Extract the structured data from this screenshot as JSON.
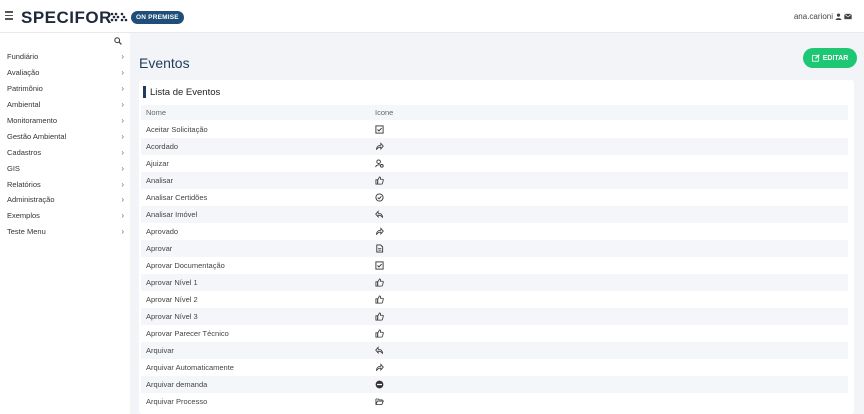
{
  "header": {
    "logo_text": "SPECIFOR",
    "badge": "ON PREMISE",
    "user": "ana.carioni"
  },
  "sidebar": {
    "items": [
      {
        "label": "Fundiário"
      },
      {
        "label": "Avaliação"
      },
      {
        "label": "Patrimônio"
      },
      {
        "label": "Ambiental"
      },
      {
        "label": "Monitoramento"
      },
      {
        "label": "Gestão Ambiental"
      },
      {
        "label": "Cadastros"
      },
      {
        "label": "GIS"
      },
      {
        "label": "Relatórios"
      },
      {
        "label": "Administração"
      },
      {
        "label": "Exemplos"
      },
      {
        "label": "Teste Menu"
      }
    ]
  },
  "page": {
    "title": "Eventos",
    "edit_label": "EDITAR"
  },
  "card": {
    "title": "Lista de Eventos",
    "col_name": "Nome",
    "col_icon": "Icone"
  },
  "events": [
    {
      "name": "Aceitar Solicitação",
      "icon": "check-square-icon"
    },
    {
      "name": "Acordado",
      "icon": "share-icon"
    },
    {
      "name": "Ajuizar",
      "icon": "user-gear-icon"
    },
    {
      "name": "Analisar",
      "icon": "thumbs-up-icon"
    },
    {
      "name": "Analisar Certidões",
      "icon": "check-circle-icon"
    },
    {
      "name": "Analisar Imóvel",
      "icon": "reply-icon"
    },
    {
      "name": "Aprovado",
      "icon": "share-icon"
    },
    {
      "name": "Aprovar",
      "icon": "file-icon"
    },
    {
      "name": "Aprovar Documentação",
      "icon": "check-square-icon"
    },
    {
      "name": "Aprovar Nível 1",
      "icon": "thumbs-up-icon"
    },
    {
      "name": "Aprovar Nível 2",
      "icon": "thumbs-up-icon"
    },
    {
      "name": "Aprovar Nível 3",
      "icon": "thumbs-up-icon"
    },
    {
      "name": "Aprovar Parecer Técnico",
      "icon": "thumbs-up-icon"
    },
    {
      "name": "Arquivar",
      "icon": "reply-icon"
    },
    {
      "name": "Arquivar Automaticamente",
      "icon": "share-icon"
    },
    {
      "name": "Arquivar demanda",
      "icon": "minus-circle-icon"
    },
    {
      "name": "Arquivar Processo",
      "icon": "folder-open-icon"
    }
  ]
}
